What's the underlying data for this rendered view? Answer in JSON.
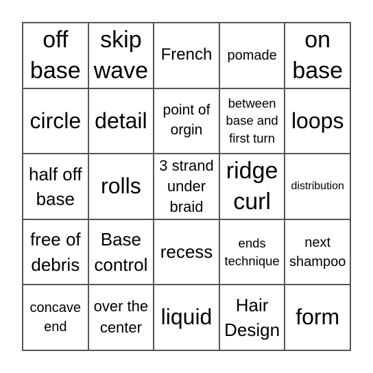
{
  "card": {
    "rows": [
      [
        "off base",
        "skip wave",
        "French",
        "pomade",
        "on base"
      ],
      [
        "circle",
        "detail",
        "point of orgin",
        "between base and first turn",
        "loops"
      ],
      [
        "half off base",
        "rolls",
        "3 strand under braid",
        "ridge curl",
        "distribution"
      ],
      [
        "free of debris",
        "Base control",
        "recess",
        "ends technique",
        "next shampoo"
      ],
      [
        "concave end",
        "over the center",
        "liquid",
        "Hair Design",
        "form"
      ]
    ]
  }
}
